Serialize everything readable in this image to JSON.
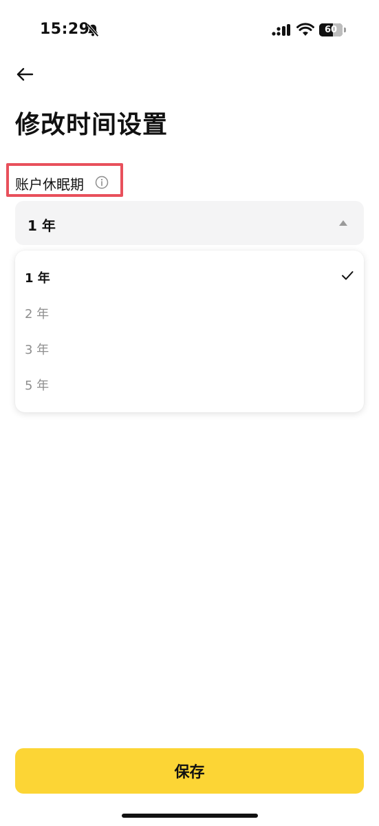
{
  "status_bar": {
    "time": "15:29",
    "battery": "60",
    "battery_level_percent": 60,
    "icons": [
      "bell-slash-icon",
      "signal-icon",
      "wifi-icon",
      "battery-icon"
    ]
  },
  "header": {
    "back_icon": "arrow-left-icon",
    "title": "修改时间设置"
  },
  "field": {
    "label": "账户休眠期",
    "info_icon": "info-circle-icon",
    "highlight_color": "#e8505b"
  },
  "select": {
    "value": "1 年",
    "caret_icon": "caret-up-icon"
  },
  "options": [
    {
      "label": "1 年",
      "selected": true
    },
    {
      "label": "2 年",
      "selected": false
    },
    {
      "label": "3 年",
      "selected": false
    },
    {
      "label": "5 年",
      "selected": false
    }
  ],
  "footer": {
    "save_label": "保存",
    "accent": "#fcd535"
  }
}
